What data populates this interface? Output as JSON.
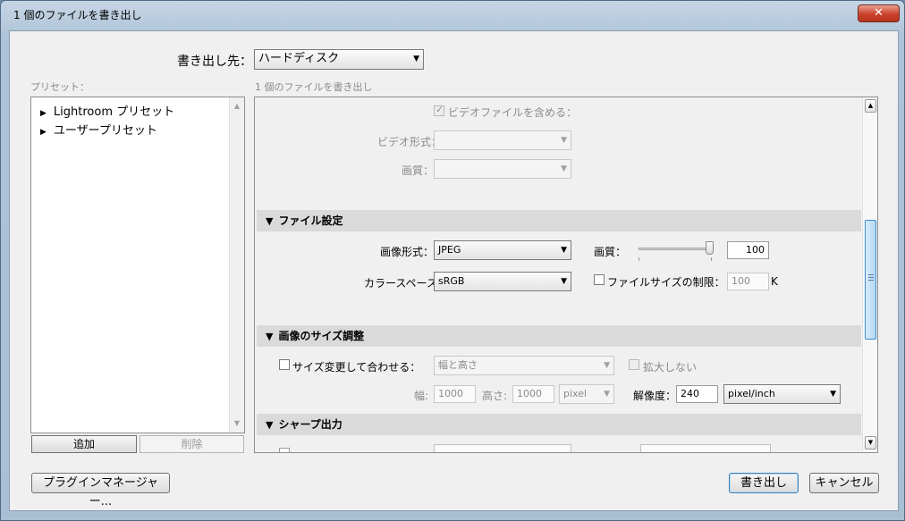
{
  "window": {
    "title": "1 個のファイルを書き出し",
    "close_label": "✕"
  },
  "export_to": {
    "label": "書き出し先：",
    "value": "ハードディスク"
  },
  "presets": {
    "header": "プリセット：",
    "items": [
      {
        "label": "Lightroom プリセット"
      },
      {
        "label": "ユーザープリセット"
      }
    ],
    "add_label": "追加",
    "delete_label": "削除"
  },
  "settings": {
    "header": "1 個のファイルを書き出し",
    "video": {
      "include_label": "ビデオファイルを含める：",
      "include_checked": true,
      "format_label": "ビデオ形式：",
      "quality_label": "画質："
    },
    "file_settings": {
      "title": "ファイル設定",
      "format_label": "画像形式：",
      "format_value": "JPEG",
      "quality_label": "画質：",
      "quality_value": "100",
      "quality_level": 1.0,
      "colorspace_label": "カラースペース：",
      "colorspace_value": "sRGB",
      "limit_label": "ファイルサイズの制限：",
      "limit_checked": false,
      "limit_value": "100",
      "limit_unit": "K"
    },
    "image_sizing": {
      "title": "画像のサイズ調整",
      "resize_label": "サイズ変更して合わせる：",
      "resize_checked": false,
      "resize_mode": "幅と高さ",
      "no_enlarge_label": "拡大しない",
      "width_label": "幅:",
      "width_value": "1000",
      "height_label": "高さ:",
      "height_value": "1000",
      "unit_value": "pixel",
      "resolution_label": "解像度：",
      "resolution_value": "240",
      "resolution_unit": "pixel/inch"
    },
    "sharpening": {
      "title": "シャープ出力"
    }
  },
  "footer": {
    "plugin_manager_label": "プラグインマネージャー...",
    "export_label": "書き出し",
    "cancel_label": "キャンセル"
  }
}
